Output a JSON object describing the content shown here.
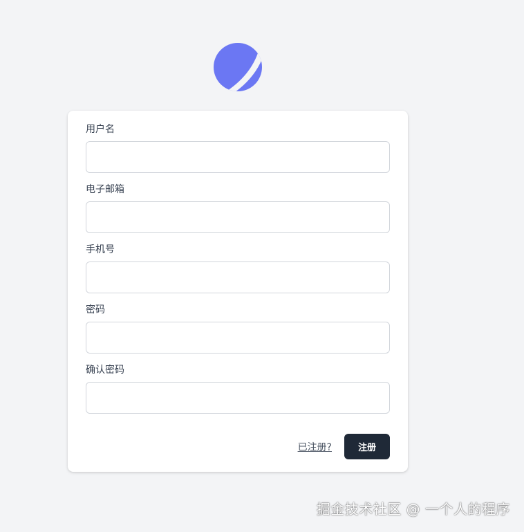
{
  "logo": {
    "icon": "planet-logo-icon",
    "color": "#6b77f3"
  },
  "form": {
    "fields": [
      {
        "label": "用户名",
        "value": "",
        "placeholder": ""
      },
      {
        "label": "电子邮箱",
        "value": "",
        "placeholder": ""
      },
      {
        "label": "手机号",
        "value": "",
        "placeholder": ""
      },
      {
        "label": "密码",
        "value": "",
        "placeholder": ""
      },
      {
        "label": "确认密码",
        "value": "",
        "placeholder": ""
      }
    ],
    "login_link": "已注册?",
    "submit_label": "注册"
  },
  "watermark": "掘金技术社区 @ 一个人的程序",
  "colors": {
    "background": "#f3f4f6",
    "card": "#ffffff",
    "button": "#1f2937",
    "accent": "#6b77f3"
  }
}
